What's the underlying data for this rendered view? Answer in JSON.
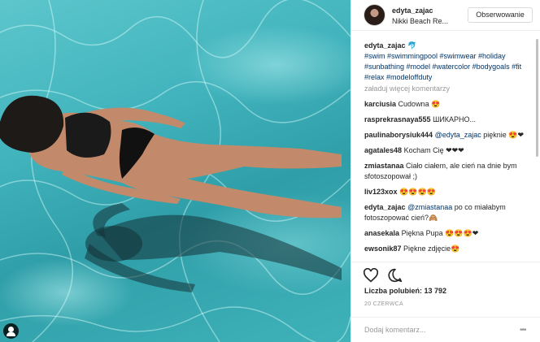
{
  "post": {
    "username": "edyta_zajac",
    "location": "Nikki Beach Re...",
    "follow_label": "Obserwowanie",
    "caption_user": "edyta_zajac",
    "caption_emoji": "🐬",
    "hashtags": "#swim #swimmingpool #swimwear #holiday #sunbathing #model #watercolor #bodygoals #fit #relax #modeloffduty",
    "load_more_label": "załaduj więcej komentarzy",
    "likes_label": "Liczba polubień: 13 792",
    "date": "20 CZERWCA",
    "comment_placeholder": "Dodaj komentarz...",
    "more_options": "•••"
  },
  "comments": [
    {
      "user": "karciusia",
      "text": "Cudowna 😍"
    },
    {
      "user": "rasprekrasnaya555",
      "text": "ШИКАРНО..."
    },
    {
      "user": "paulinaborysiuk444",
      "mention": "@edyta_zajac",
      "text": " pięknie 😍❤"
    },
    {
      "user": "agatales48",
      "text": "Kocham Cię ❤❤❤"
    },
    {
      "user": "zmiastanaa",
      "text": "Ciało ciałem, ale cień na dnie bym sfotoszopował ;)"
    },
    {
      "user": "liv123xox",
      "text": "😍😍😍😍"
    },
    {
      "user": "edyta_zajac",
      "mention": "@zmiastanaa",
      "text": " po co miałabym fotoszopować cień?🙈"
    },
    {
      "user": "anasekala",
      "text": "Piękna Pupa 😍😍😍❤"
    },
    {
      "user": "ewsonik87",
      "text": "Piękne zdjęcie😍"
    }
  ]
}
